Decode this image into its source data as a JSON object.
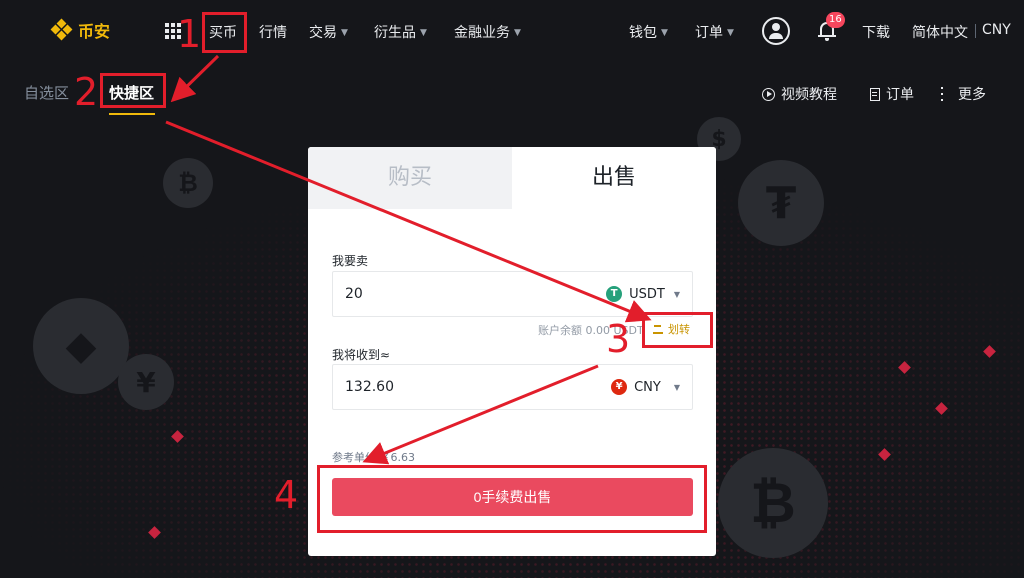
{
  "brand": {
    "name": "币安"
  },
  "topnav": {
    "items": [
      {
        "label": "买币",
        "dropdown": false
      },
      {
        "label": "行情",
        "dropdown": false
      },
      {
        "label": "交易",
        "dropdown": true
      },
      {
        "label": "衍生品",
        "dropdown": true
      },
      {
        "label": "金融业务",
        "dropdown": true
      }
    ],
    "right": {
      "wallet": "钱包",
      "orders": "订单",
      "notifications_count": "16",
      "download": "下载",
      "language": "简体中文",
      "currency": "CNY"
    }
  },
  "subnav": {
    "tabs": [
      {
        "label": "自选区",
        "active": false
      },
      {
        "label": "快捷区",
        "active": true
      }
    ],
    "right_links": [
      {
        "label": "视频教程",
        "icon": "play-circle-icon"
      },
      {
        "label": "订单",
        "icon": "document-icon"
      },
      {
        "label": "更多",
        "icon": "more-vertical-icon"
      }
    ]
  },
  "card": {
    "tabs": [
      {
        "label": "购买",
        "active": false
      },
      {
        "label": "出售",
        "active": true
      }
    ],
    "sell": {
      "label": "我要卖",
      "amount": "20",
      "currency": "USDT",
      "currency_icon_letter": "T",
      "balance_text": "账户余额 0.00 USDT",
      "transfer_label": "划转"
    },
    "receive": {
      "label": "我将收到≈",
      "amount": "132.60",
      "currency": "CNY",
      "currency_icon_letter": "¥"
    },
    "ref_price": "参考单价 ￥6.63",
    "submit_label": "0手续费出售"
  },
  "annotations": {
    "numbers": [
      "1",
      "2",
      "3",
      "4"
    ]
  },
  "colors": {
    "accent": "#f0b90b",
    "sell_button": "#ea4a5f",
    "annotation_red": "#e21e2b",
    "usdt_green": "#26a17b",
    "cny_red": "#de2910"
  }
}
